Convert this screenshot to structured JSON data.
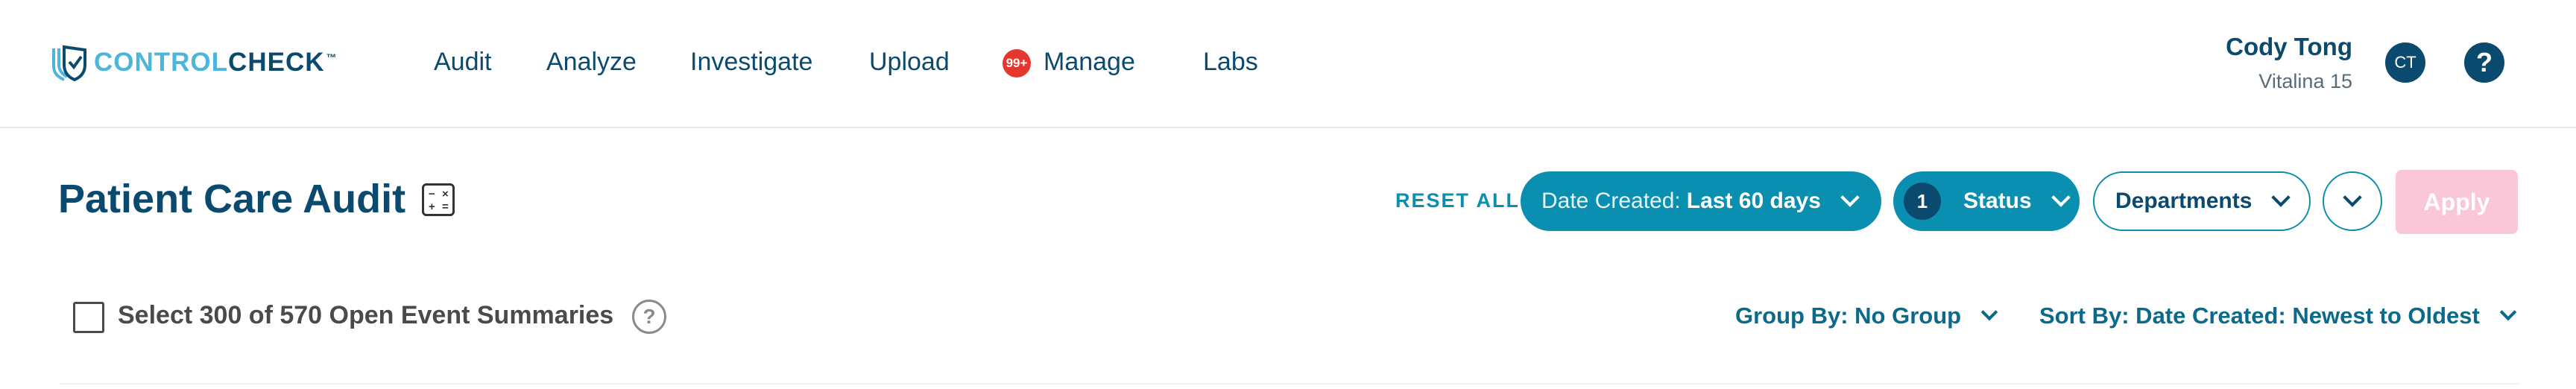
{
  "brand": {
    "part1": "CONTROL",
    "part2": "CHECK",
    "tm": "™"
  },
  "nav": {
    "items": [
      "Audit",
      "Analyze",
      "Investigate",
      "Upload",
      "Manage",
      "Labs"
    ],
    "manage_badge": "99+"
  },
  "user": {
    "name": "Cody Tong",
    "org": "Vitalina 15",
    "initials": "CT"
  },
  "help": {
    "glyph": "?"
  },
  "page": {
    "title": "Patient Care Audit",
    "reset_label": "RESET ALL",
    "filters": {
      "date_label": "Date Created:",
      "date_value": "Last 60 days",
      "status_count": "1",
      "status_label": "Status",
      "departments_label": "Departments"
    },
    "apply_label": "Apply"
  },
  "list": {
    "select_label": "Select 300 of 570 Open Event Summaries",
    "help_glyph": "?",
    "group_by": "Group By: No Group",
    "sort_by": "Sort By: Date Created: Newest to Oldest"
  },
  "colors": {
    "brand_dark": "#0b4a6f",
    "brand_light": "#4cb5dc",
    "accent": "#0a8fb0",
    "badge": "#e6372e",
    "apply_disabled": "#f9c7d8"
  },
  "icons": {
    "logo": "shield-check-icon",
    "calculator": "calculator-icon",
    "chevron": "chevron-down-icon",
    "help": "question-circle-icon"
  }
}
